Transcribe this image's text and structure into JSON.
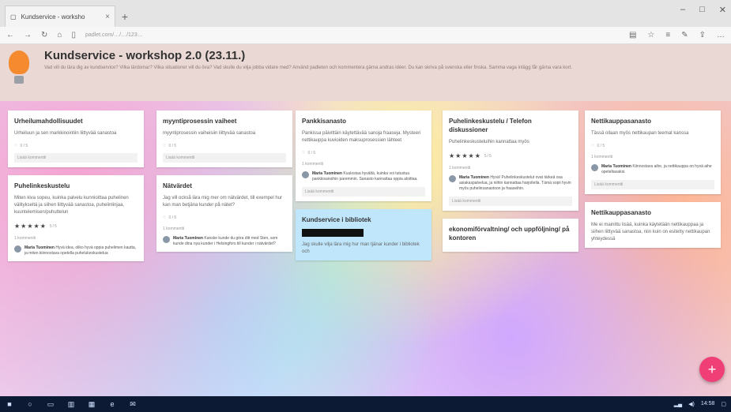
{
  "browser": {
    "tab_title": "Kundservice - worksho",
    "new_tab": "+",
    "url": "padlet.com/…/…/123…",
    "window_controls": [
      "–",
      "□",
      "✕"
    ]
  },
  "header": {
    "title": "Kundservice - workshop 2.0 (23.11.)",
    "description": "Vad vill du lära dig av kundservice? Vilka lärdomar? Vilka situationer vill du öva? Vad skulle du vilja jobba vidare med? Använd padleten och kommentera gärna andras idéer. Du kan skriva på svenska eller finska. Samma vaga inlägg får gärna vara kort."
  },
  "columns": [
    {
      "cards": [
        {
          "title": "Urheilumahdollisuudet",
          "body": "Urheiluun ja sen markkinointiin liittyvää sanastoa",
          "meta": "0 / 5",
          "add_comment": "Lisää kommentti"
        },
        {
          "title": "Puhelinkeskustelu",
          "body": "Miten kiva sopeu, kuinka palvelu kunnioittaa puhelinen välitykseltä ja siihen liittyvää sanastoa, puhelinlinjaa, kuuntelemisen/puhuttelun",
          "stars": "★★★★★",
          "star_count": "5/5",
          "comments_label": "1 kommentti",
          "comment_name": "Maria Tuominen",
          "comment_text": "Hyvä idea, oliko hyvä oppia puhelimen kautta, ja miten kiinnostava opetella puhelukeskustelua"
        }
      ]
    },
    {
      "cards": [
        {
          "title": "myyntiprosessin vaiheet",
          "body": "myyntiprosessin vaiheisiin liittyvää sanastoa",
          "meta": "0 / 5",
          "add_comment": "Lisää kommentti"
        },
        {
          "title": "Nätvärdet",
          "body": "Jag vill också lära mig mer om nätvärdet, till exempel hur kan man betjäna kunder på nätet?",
          "meta": "0 / 5",
          "comments_label": "1 kommentti",
          "comment_name": "Maria Tuominen",
          "comment_text": "Kanske kunde du göra ditt med Sten, som kunde dina nya kunder i Helsingfors till kunder i nätvärdet?"
        }
      ]
    },
    {
      "cards": [
        {
          "title": "Pankkisanasto",
          "body": "Pankissa päivittäin käytettävää sanoja fraaseja. Mysteeri nettikauppa kuvioiden maksuprosessien lähteet",
          "meta": "0 / 5",
          "comments_label": "1 kommentti",
          "comment_name": "Maria Tuominen",
          "comment_text": "Kuulostaa hyvältä, kuinka voi tutustua pankkisanoihin paremmin. Sanasto kannattaa oppia aloittaa.",
          "add_comment": "Lisää kommentti"
        },
        {
          "title": "Kundservice i bibliotek",
          "body": "Jag skulle vilja lära mig hur man tjänar kunder i bibliotek och",
          "blue": true
        }
      ]
    },
    {
      "cards": [
        {
          "title": "Puhelinkeskustelu / Telefon diskussioner",
          "body": "Puhelinkeskusteluihin kannattaa myös",
          "stars": "★★★★★",
          "star_count": "5/5",
          "comments_label": "1 kommentti",
          "comment_name": "Maria Tuominen",
          "comment_text": "Hyvä! Puhelinkeskustelut ovat tärkeä osa asiakaspalvelua, ja niihin kannattaa harjoitella. Tämä sopii hyvin myös puhelinsanastoon ja fraaseihin.",
          "add_comment": "Lisää kommentti"
        },
        {
          "title": "ekonomiförvaltning/ och uppföljning/ på kontoren",
          "body": ""
        }
      ]
    },
    {
      "cards": [
        {
          "title": "Nettikauppasanasto",
          "body": "Tässä ollaan myös nettikaupan teemat kanssa",
          "meta": "0 / 5",
          "comments_label": "1 kommentti",
          "comment_name": "Maria Tuominen",
          "comment_text": "Kiinnostava aihe, ja nettikauppa on hyvä aihe opeteltavaksi.",
          "add_comment": "Lisää kommentti"
        },
        {
          "title": "Nettikauppasanasto",
          "body": "Me ei mainittu lisää, kuinka käytetään nettikauppaa ja siihen liittyvää sanastoa, niin kuin on esitetty nettikaupan yhteydessä"
        }
      ]
    }
  ],
  "fab_label": "+",
  "taskbar": {
    "clock": "14:58"
  },
  "colors": {
    "header_bg": "#ead8d4",
    "fab": "#ef3f76",
    "taskbar": "#0c1b33"
  }
}
